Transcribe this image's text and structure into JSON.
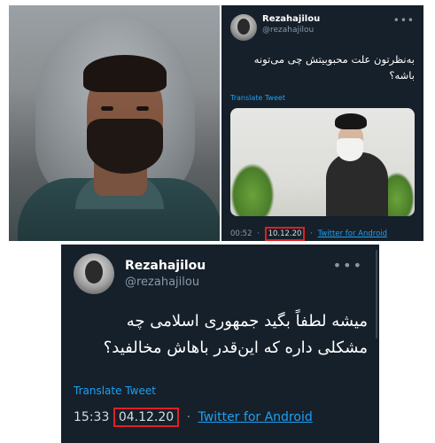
{
  "tweet_top": {
    "name": "Rezahajilou",
    "handle": "@rezahajilou",
    "more_icon": "more-horizontal-icon",
    "text": "به‌نظرتون علت محبوبیتش چی می‌تونه باشه؟",
    "translate_label": "Translate Tweet",
    "time": "00:52",
    "date": "10.12.20",
    "separator": "·",
    "source": "Twitter for Android"
  },
  "tweet_bottom": {
    "name": "Rezahajilou",
    "handle": "@rezahajilou",
    "more_icon": "more-horizontal-icon",
    "text": "میشه لطفاً بگید جمهوری اسلامی چه مشکلی داره که این‌قدر باهاش مخالفید؟",
    "translate_label": "Translate Tweet",
    "time": "15:33",
    "date": "04.12.20",
    "separator": "·",
    "source": "Twitter for Android"
  },
  "colors": {
    "card_background": "#15202b",
    "link_blue": "#1da1f2",
    "highlight_red": "#e02020",
    "muted_text": "#8899a6"
  }
}
